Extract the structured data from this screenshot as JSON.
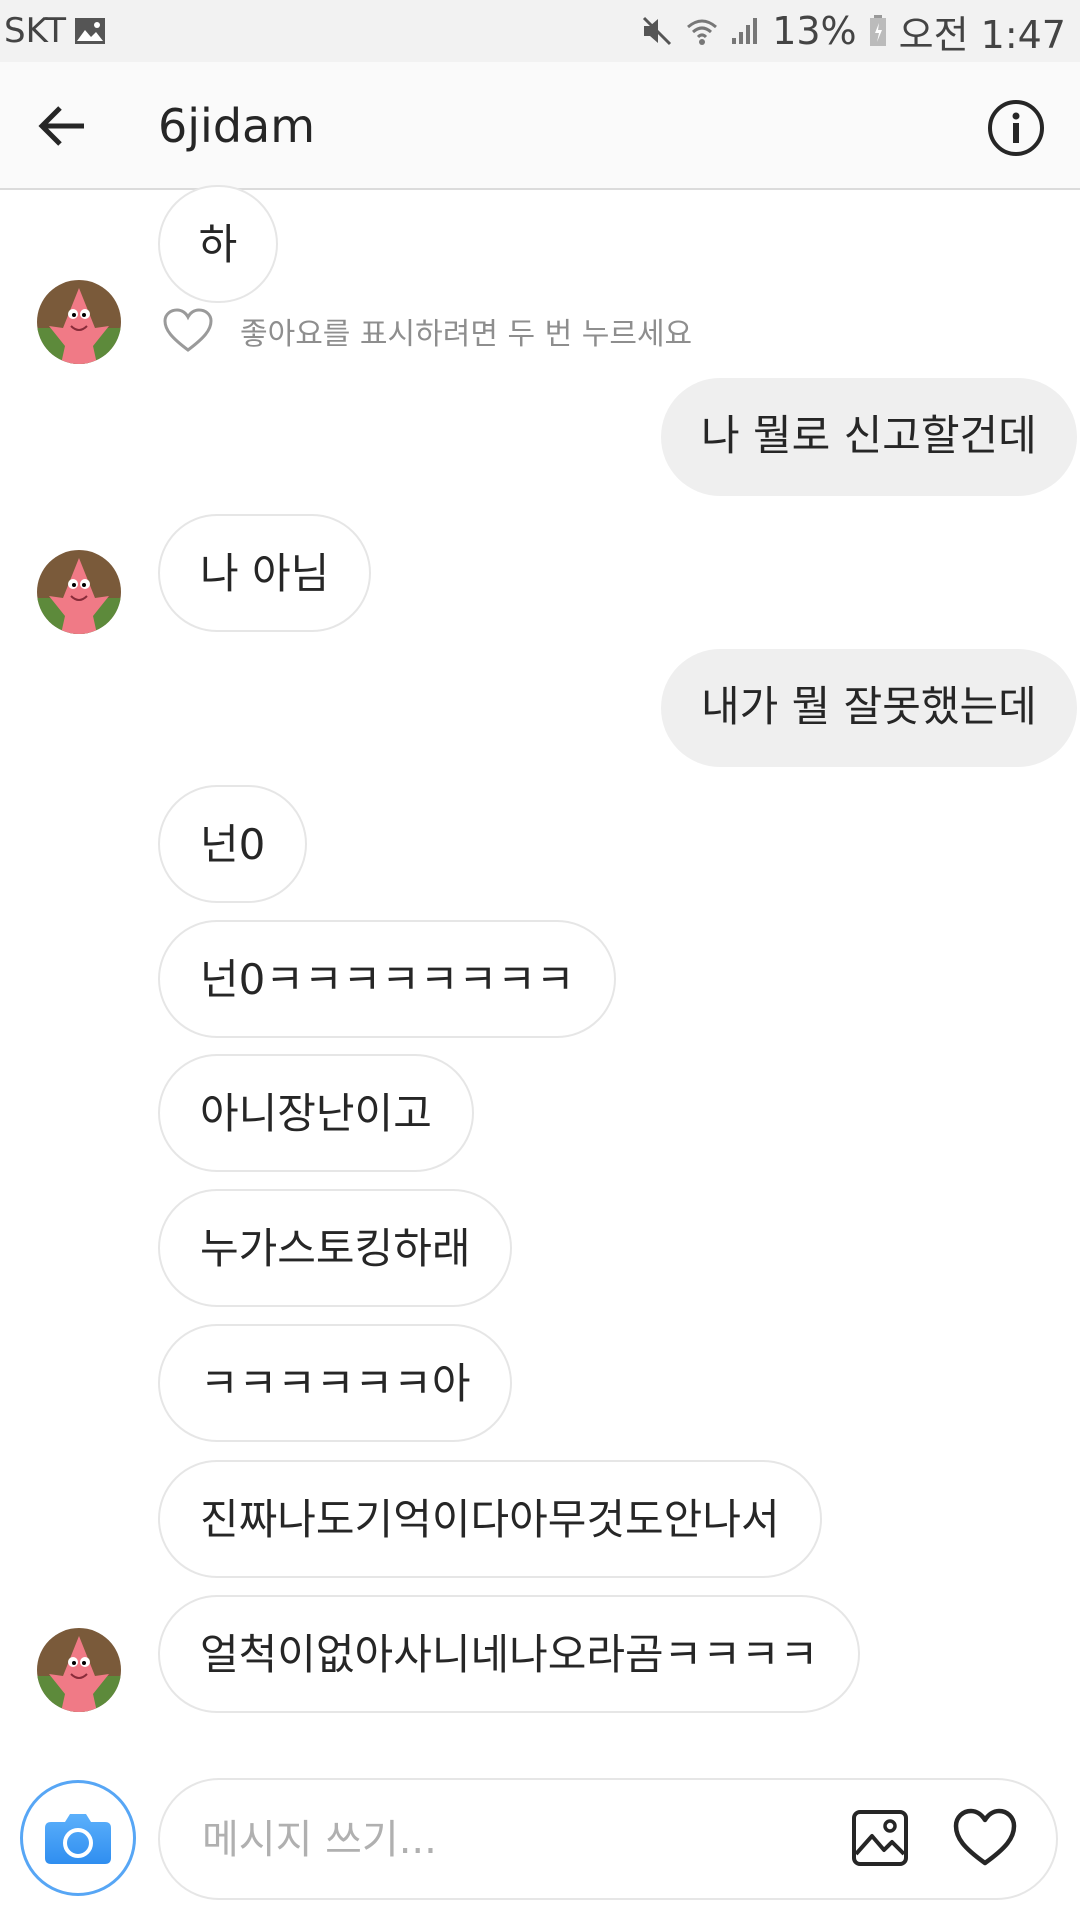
{
  "status_bar": {
    "carrier": "SKT",
    "battery": "13%",
    "time": "오전 1:47",
    "icons": [
      "gallery-icon",
      "mute-icon",
      "wifi-icon",
      "signal-icon",
      "battery-icon"
    ]
  },
  "header": {
    "title": "6jidam",
    "back_icon": "arrow-left-icon",
    "info_icon": "info-icon"
  },
  "messages": [
    {
      "text": "하",
      "side": "in"
    },
    {
      "text": "나 뭘로 신고할건데",
      "side": "out"
    },
    {
      "text": "나 아님",
      "side": "in"
    },
    {
      "text": "내가 뭘 잘못했는데",
      "side": "out"
    },
    {
      "text": "넌0",
      "side": "in"
    },
    {
      "text": "넌0ㅋㅋㅋㅋㅋㅋㅋㅋ",
      "side": "in"
    },
    {
      "text": "아니장난이고",
      "side": "in"
    },
    {
      "text": "누가스토킹하래",
      "side": "in"
    },
    {
      "text": "ㅋㅋㅋㅋㅋㅋ아",
      "side": "in"
    },
    {
      "text": "진짜나도기억이다아무것도안나서",
      "side": "in"
    },
    {
      "text": "얼척이없아사니네나오라곰ㅋㅋㅋㅋ",
      "side": "in"
    }
  ],
  "like_hint": "좋아요를 표시하려면 두 번 누르세요",
  "composer": {
    "placeholder": "메시지 쓰기...",
    "camera_icon": "camera-icon",
    "gallery_icon": "image-icon",
    "heart_icon": "heart-icon"
  },
  "colors": {
    "incoming_border": "#e6e6e6",
    "outgoing_bg": "#efefef",
    "camera_blue": "#3897f0"
  }
}
